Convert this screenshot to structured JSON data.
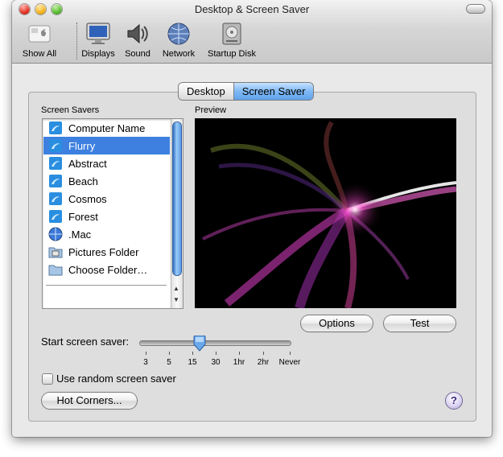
{
  "window": {
    "title": "Desktop & Screen Saver"
  },
  "toolbar": {
    "show_all": "Show All",
    "items": [
      "Displays",
      "Sound",
      "Network",
      "Startup Disk"
    ]
  },
  "tabs": {
    "desktop": "Desktop",
    "screen_saver": "Screen Saver",
    "selected": "Screen Saver"
  },
  "screen_savers": {
    "label": "Screen Savers",
    "items": [
      "Computer Name",
      "Flurry",
      "Abstract",
      "Beach",
      "Cosmos",
      "Forest",
      ".Mac",
      "Pictures Folder",
      "Choose Folder…"
    ],
    "selected": "Flurry"
  },
  "preview": {
    "label": "Preview"
  },
  "buttons": {
    "options": "Options",
    "test": "Test",
    "hot_corners": "Hot Corners..."
  },
  "start_saver": {
    "label": "Start screen saver:",
    "ticks": [
      "3",
      "5",
      "15",
      "30",
      "1hr",
      "2hr",
      "Never"
    ],
    "value": "15"
  },
  "random": {
    "label": "Use random screen saver",
    "checked": false
  },
  "help": {
    "glyph": "?"
  },
  "colors": {
    "selection": "#3d80df",
    "tab_active": "#7fb8f4"
  }
}
